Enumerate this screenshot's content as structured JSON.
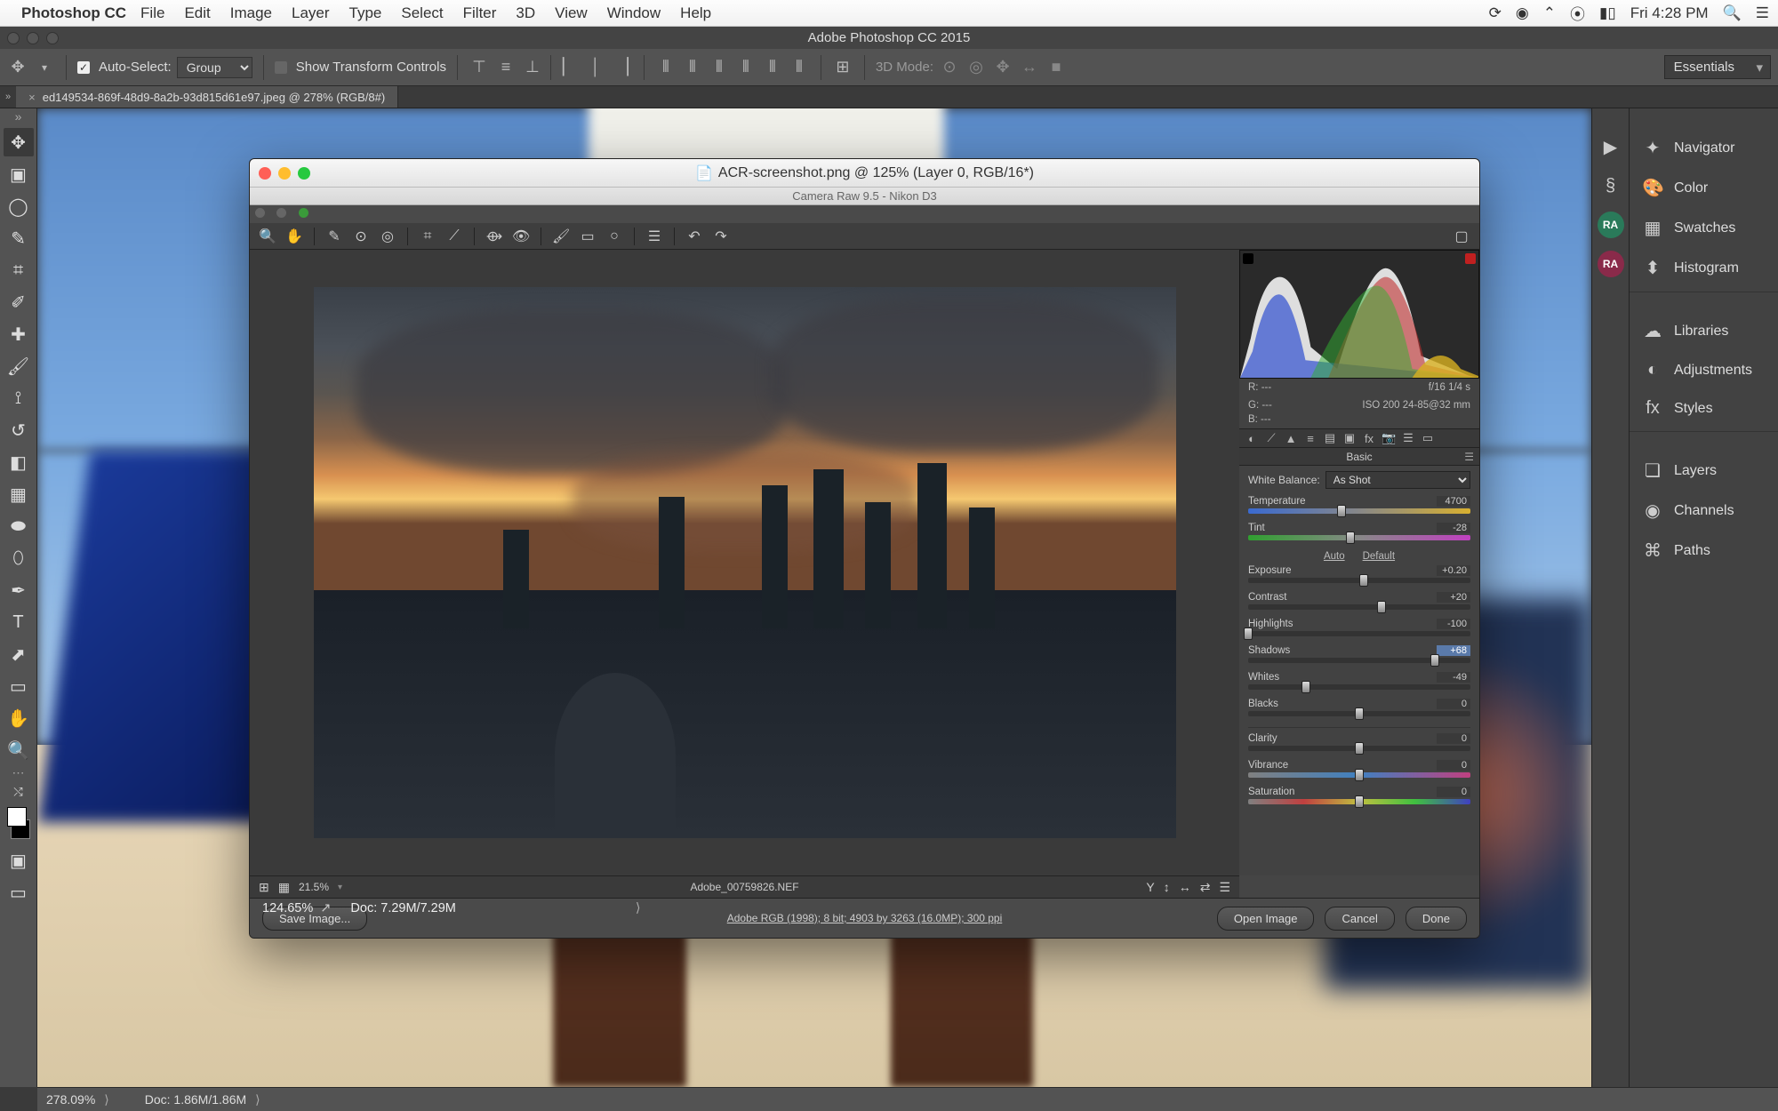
{
  "menubar": {
    "app": "Photoshop CC",
    "items": [
      "File",
      "Edit",
      "Image",
      "Layer",
      "Type",
      "Select",
      "Filter",
      "3D",
      "View",
      "Window",
      "Help"
    ],
    "clock": "Fri 4:28 PM"
  },
  "ps_title": "Adobe Photoshop CC 2015",
  "options": {
    "auto_select": "Auto-Select:",
    "group": "Group",
    "show_transform": "Show Transform Controls",
    "mode3d": "3D Mode:",
    "workspace": "Essentials"
  },
  "doc_tab": "ed149534-869f-48d9-8a2b-93d815d61e97.jpeg @ 278% (RGB/8#)",
  "panels": [
    "Navigator",
    "Color",
    "Swatches",
    "Histogram",
    "Libraries",
    "Adjustments",
    "Styles",
    "Layers",
    "Channels",
    "Paths"
  ],
  "badge": "RA",
  "status": {
    "zoom": "278.09%",
    "doc": "Doc: 1.86M/1.86M"
  },
  "acr": {
    "title": "ACR-screenshot.png @ 125% (Layer 0, RGB/16*)",
    "subtitle": "Camera Raw 9.5  -  Nikon D3",
    "meta": {
      "r": "R:   ---",
      "g": "G:   ---",
      "b": "B:   ---",
      "fstop": "f/16   1/4 s",
      "iso": "ISO 200   24-85@32 mm"
    },
    "panel_name": "Basic",
    "wb_label": "White Balance:",
    "wb_value": "As Shot",
    "auto": "Auto",
    "default": "Default",
    "sliders": {
      "temperature": {
        "label": "Temperature",
        "value": "4700",
        "pos": 42
      },
      "tint": {
        "label": "Tint",
        "value": "-28",
        "pos": 46
      },
      "exposure": {
        "label": "Exposure",
        "value": "+0.20",
        "pos": 52
      },
      "contrast": {
        "label": "Contrast",
        "value": "+20",
        "pos": 60
      },
      "highlights": {
        "label": "Highlights",
        "value": "-100",
        "pos": 0
      },
      "shadows": {
        "label": "Shadows",
        "value": "+68",
        "pos": 84,
        "hl": true
      },
      "whites": {
        "label": "Whites",
        "value": "-49",
        "pos": 26
      },
      "blacks": {
        "label": "Blacks",
        "value": "0",
        "pos": 50
      },
      "clarity": {
        "label": "Clarity",
        "value": "0",
        "pos": 50
      },
      "vibrance": {
        "label": "Vibrance",
        "value": "0",
        "pos": 50
      },
      "saturation": {
        "label": "Saturation",
        "value": "0",
        "pos": 50
      }
    },
    "preview": {
      "zoom": "21.5%",
      "filename": "Adobe_00759826.NEF"
    },
    "profile_link": "Adobe RGB (1998); 8 bit; 4903 by 3263 (16.0MP); 300 ppi",
    "buttons": {
      "save": "Save Image...",
      "open": "Open Image",
      "cancel": "Cancel",
      "done": "Done"
    },
    "inner_status": {
      "zoom": "124.65%",
      "doc": "Doc: 7.29M/7.29M"
    }
  }
}
